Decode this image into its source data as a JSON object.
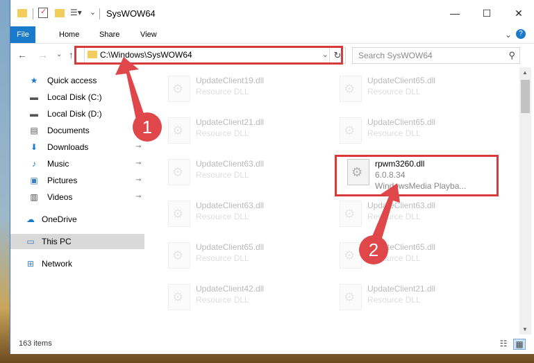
{
  "window": {
    "title": "SysWOW64",
    "controls": {
      "minimize": "—",
      "maximize": "☐",
      "close": "✕"
    }
  },
  "ribbon": {
    "tabs": [
      "File",
      "Home",
      "Share",
      "View"
    ],
    "help": "?",
    "collapse": "⌄"
  },
  "address_bar": {
    "path": "C:\\Windows\\SysWOW64",
    "dropdown": "⌄",
    "refresh": "↻"
  },
  "search": {
    "placeholder": "Search SysWOW64",
    "icon": "search-icon"
  },
  "nav_buttons": {
    "back": "←",
    "forward": "→",
    "recent": "⌄",
    "up": "↑"
  },
  "sidebar": {
    "items": [
      {
        "label": "Quick access",
        "icon": "★",
        "pinned": false
      },
      {
        "label": "Local Disk (C:)",
        "icon": "▬",
        "pinned": false
      },
      {
        "label": "Local Disk (D:)",
        "icon": "▬",
        "pinned": false
      },
      {
        "label": "Documents",
        "icon": "▤",
        "pinned": false
      },
      {
        "label": "Downloads",
        "icon": "⬇",
        "pinned": true
      },
      {
        "label": "Music",
        "icon": "♪",
        "pinned": true
      },
      {
        "label": "Pictures",
        "icon": "▣",
        "pinned": true
      },
      {
        "label": "Videos",
        "icon": "▥",
        "pinned": true
      },
      {
        "label": "OneDrive",
        "icon": "☁",
        "pinned": false
      },
      {
        "label": "This PC",
        "icon": "▭",
        "pinned": false,
        "selected": true
      },
      {
        "label": "Network",
        "icon": "⊞",
        "pinned": false
      }
    ],
    "pin_glyph": "📌"
  },
  "files": [
    {
      "name": "UpdateClient19.dll",
      "desc": "Resource DLL",
      "faded": true
    },
    {
      "name": "UpdateClient65.dll",
      "desc": "Resource DLL",
      "faded": true
    },
    {
      "name": "UpdateClient21.dll",
      "desc": "Resource DLL",
      "faded": true
    },
    {
      "name": "UpdateClient65.dll",
      "desc": "Resource DLL",
      "faded": true
    },
    {
      "name": "UpdateClient63.dll",
      "desc": "Resource DLL",
      "faded": true
    },
    {
      "name": "rpwm3260.dll",
      "desc": "6.0.8.34",
      "desc2": "WindowsMedia Playba...",
      "faded": false
    },
    {
      "name": "UpdateClient63.dll",
      "desc": "Resource DLL",
      "faded": true
    },
    {
      "name": "UpdateClient63.dll",
      "desc": "Resource DLL",
      "faded": true
    },
    {
      "name": "UpdateClient65.dll",
      "desc": "Resource DLL",
      "faded": true
    },
    {
      "name": "UpdateClient65.dll",
      "desc": "Resource DLL",
      "faded": true
    },
    {
      "name": "UpdateClient42.dll",
      "desc": "Resource DLL",
      "faded": true
    },
    {
      "name": "UpdateClient21.dll",
      "desc": "Resource DLL",
      "faded": true
    }
  ],
  "status": {
    "count": "163 items"
  },
  "annotations": {
    "step1": "1",
    "step2": "2",
    "highlight_color": "#d9393b",
    "badge_color": "#e0474a"
  },
  "colors": {
    "accent": "#1979ca",
    "folder": "#f3cd5b"
  }
}
